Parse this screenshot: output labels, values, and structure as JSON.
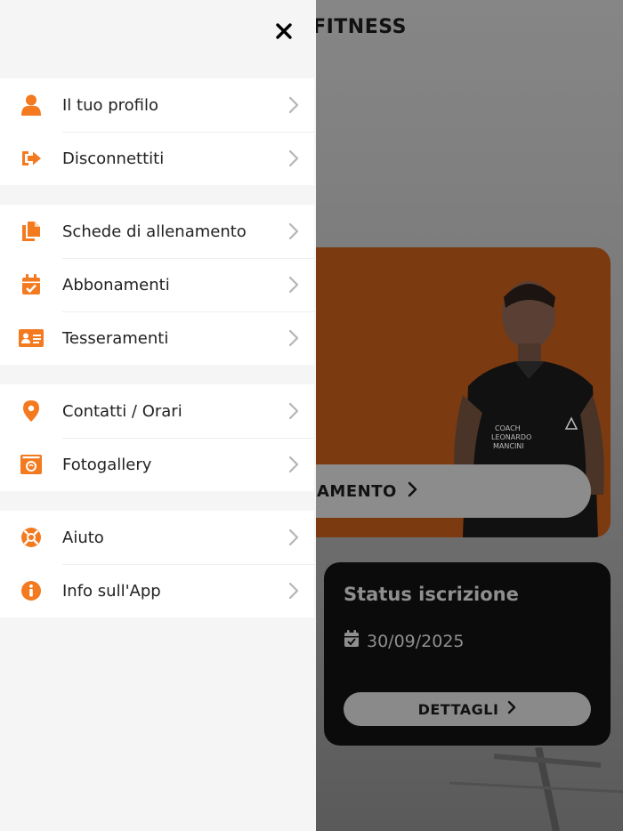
{
  "colors": {
    "accent": "#f47a20",
    "drawer_bg": "#f5f5f5",
    "hero_bg": "#7c3a10",
    "status_card_bg": "#0b0b0b"
  },
  "background": {
    "title_visible": "FITNESS",
    "hero_button_label": "AMENTO",
    "status_card": {
      "title": "Status iscrizione",
      "date": "30/09/2025",
      "button_label": "DETTAGLI"
    }
  },
  "drawer": {
    "close_icon": "close-icon",
    "groups": [
      {
        "items": [
          {
            "label": "Il tuo profilo",
            "icon": "user-icon"
          },
          {
            "label": "Disconnettiti",
            "icon": "sign-out-icon"
          }
        ]
      },
      {
        "items": [
          {
            "label": "Schede di allenamento",
            "icon": "copy-icon"
          },
          {
            "label": "Abbonamenti",
            "icon": "calendar-check-icon"
          },
          {
            "label": "Tesseramenti",
            "icon": "id-card-icon"
          }
        ]
      },
      {
        "items": [
          {
            "label": "Contatti / Orari",
            "icon": "map-marker-icon"
          },
          {
            "label": "Fotogallery",
            "icon": "photo-icon"
          }
        ]
      },
      {
        "items": [
          {
            "label": "Aiuto",
            "icon": "lifebuoy-icon"
          },
          {
            "label": "Info sull'App",
            "icon": "info-icon"
          }
        ]
      }
    ]
  }
}
